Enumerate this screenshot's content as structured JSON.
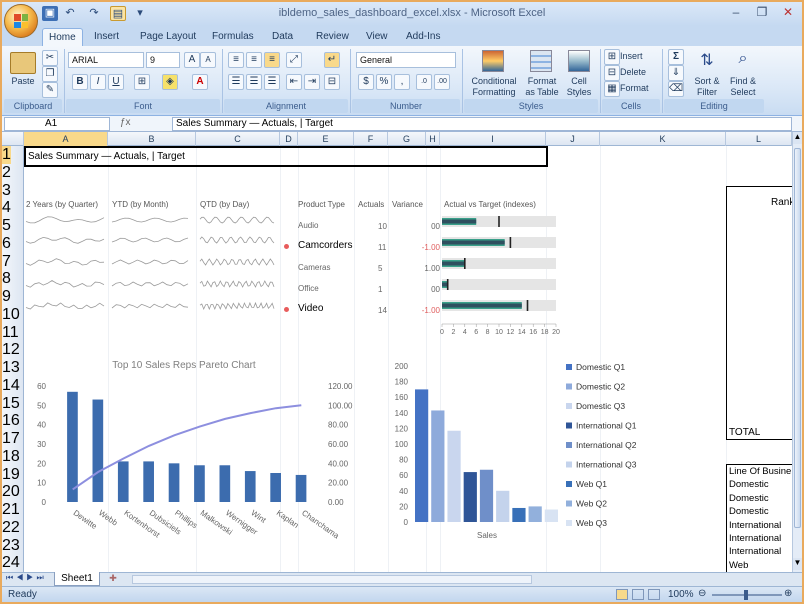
{
  "window": {
    "title": "ibldemo_sales_dashboard_excel.xlsx - Microsoft Excel",
    "minimize": "–",
    "restore": "❐",
    "close": "✕"
  },
  "ribbon_tabs": [
    "Home",
    "Insert",
    "Page Layout",
    "Formulas",
    "Data",
    "Review",
    "View",
    "Add-Ins"
  ],
  "ribbon": {
    "paste": "Paste",
    "font_name": "ARIAL",
    "font_size": "9",
    "number_format": "General",
    "conditional_formatting": "Conditional Formatting",
    "format_as_table": "Format as Table",
    "cell_styles": "Cell Styles",
    "insert": "Insert",
    "delete": "Delete",
    "format": "Format",
    "sort_filter": "Sort & Filter",
    "find_select": "Find & Select",
    "groups": [
      "Clipboard",
      "Font",
      "Alignment",
      "Number",
      "Styles",
      "Cells",
      "Editing"
    ]
  },
  "formula_bar": {
    "name_box": "A1",
    "formula": "Sales Summary — Actuals, | Target"
  },
  "columns": [
    "A",
    "B",
    "C",
    "D",
    "E",
    "F",
    "G",
    "H",
    "I",
    "J",
    "K",
    "L"
  ],
  "rows": [
    "1",
    "2",
    "3",
    "4",
    "5",
    "6",
    "7",
    "8",
    "9",
    "10",
    "11",
    "12",
    "13",
    "14",
    "15",
    "16",
    "17",
    "18",
    "19",
    "20",
    "21",
    "22",
    "23",
    "24"
  ],
  "cells": {
    "a1": "Sales Summary — Actuals, | Target",
    "headers": {
      "years": "2 Years (by Quarter)",
      "ytd": "YTD (by Month)",
      "qtd": "QTD (by Day)",
      "product_type": "Product Type",
      "actuals": "Actuals",
      "variance": "Variance",
      "avt": "Actual vs Target (indexes)"
    },
    "products": [
      {
        "name": "Audio",
        "actual": "10",
        "variance": "00",
        "neg": false,
        "flag": false,
        "big": false,
        "actual_val": 6,
        "target_val": 10
      },
      {
        "name": "Camcorders",
        "actual": "11",
        "variance": "-1.00",
        "neg": true,
        "flag": true,
        "big": true,
        "actual_val": 11,
        "target_val": 12
      },
      {
        "name": "Cameras",
        "actual": "5",
        "variance": "1.00",
        "neg": false,
        "flag": false,
        "big": false,
        "actual_val": 4,
        "target_val": 4
      },
      {
        "name": "Office",
        "actual": "1",
        "variance": "00",
        "neg": false,
        "flag": false,
        "big": false,
        "actual_val": 1,
        "target_val": 1
      },
      {
        "name": "Video",
        "actual": "14",
        "variance": "-1.00",
        "neg": true,
        "flag": true,
        "big": true,
        "actual_val": 14,
        "target_val": 15
      }
    ],
    "bullet_axis": [
      "0",
      "2",
      "4",
      "6",
      "8",
      "10",
      "12",
      "14",
      "16",
      "18",
      "20"
    ],
    "right_panel": {
      "header": "Rank",
      "total": "TOTAL",
      "line_header": "Line Of Busine",
      "lines": [
        "Domestic",
        "Domestic",
        "Domestic",
        "International",
        "International",
        "International",
        "Web"
      ]
    }
  },
  "chart_data": [
    {
      "type": "bar",
      "title": "Top 10 Sales Reps Pareto Chart",
      "categories": [
        "Dewitte",
        "Webb",
        "Kortenhorst",
        "Dubsiciels",
        "Phillips",
        "Malkowski",
        "Wernigger",
        "Wint",
        "Kaplan",
        "Chanchama"
      ],
      "values": [
        57,
        53,
        21,
        21,
        20,
        19,
        19,
        16,
        15,
        14
      ],
      "ylim": [
        0,
        60
      ],
      "yticks": [
        "0",
        "10",
        "20",
        "30",
        "40",
        "50",
        "60"
      ],
      "y2ticks": [
        "0.00",
        "20.00",
        "40.00",
        "60.00",
        "80.00",
        "100.00",
        "120.00"
      ],
      "line": {
        "type": "line",
        "y2lim": [
          0,
          120
        ],
        "values": [
          13,
          31,
          45,
          58,
          69,
          78,
          86,
          92,
          97,
          100
        ]
      },
      "color": "#3c6cae",
      "line_color": "#8d8fdf"
    },
    {
      "type": "bar",
      "xlabel": "Sales",
      "ylim": [
        0,
        200
      ],
      "yticks": [
        "0",
        "20",
        "40",
        "60",
        "80",
        "100",
        "120",
        "140",
        "160",
        "180",
        "200"
      ],
      "series": [
        {
          "name": "Domestic Q1",
          "values": [
            170
          ],
          "color": "#4472c4"
        },
        {
          "name": "Domestic Q2",
          "values": [
            143
          ],
          "color": "#8eaadb"
        },
        {
          "name": "Domestic Q3",
          "values": [
            117
          ],
          "color": "#c9d6ee"
        },
        {
          "name": "International Q1",
          "values": [
            64
          ],
          "color": "#2f5597"
        },
        {
          "name": "International Q2",
          "values": [
            67
          ],
          "color": "#6f8fc9"
        },
        {
          "name": "International Q3",
          "values": [
            40
          ],
          "color": "#c4d3ec"
        },
        {
          "name": "Web Q1",
          "values": [
            18
          ],
          "color": "#3870b8"
        },
        {
          "name": "Web Q2",
          "values": [
            20
          ],
          "color": "#92b0dc"
        },
        {
          "name": "Web Q3",
          "values": [
            16
          ],
          "color": "#d8e3f3"
        }
      ]
    }
  ],
  "sheet_tab": "Sheet1",
  "status": {
    "ready": "Ready",
    "zoom": "100%"
  },
  "colors": {
    "accent": "#e9aa5d",
    "ribbon": "#c5d9f1",
    "negative": "#e06060",
    "flag": "#e85c5c",
    "bullet_actual": "#2f4f5f",
    "bullet_mid": "#3aa08a"
  }
}
